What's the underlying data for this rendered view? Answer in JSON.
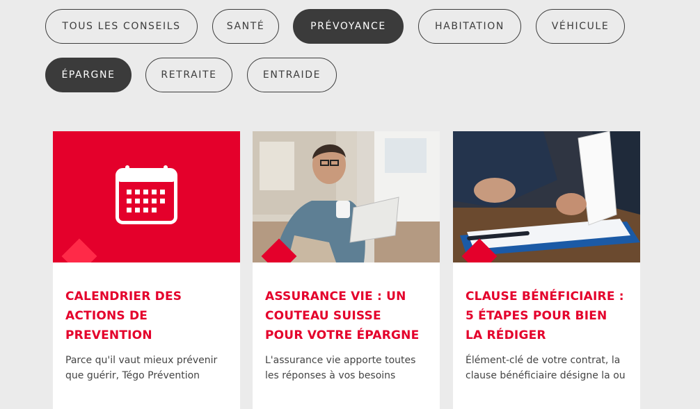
{
  "filters": {
    "items": [
      {
        "label": "TOUS LES CONSEILS",
        "active": false
      },
      {
        "label": "SANTÉ",
        "active": false
      },
      {
        "label": "PRÉVOYANCE",
        "active": true
      },
      {
        "label": "HABITATION",
        "active": false
      },
      {
        "label": "VÉHICULE",
        "active": false
      },
      {
        "label": "ÉPARGNE",
        "active": true
      },
      {
        "label": "RETRAITE",
        "active": false
      },
      {
        "label": "ENTRAIDE",
        "active": false
      }
    ]
  },
  "cards": [
    {
      "title_lines": [
        "CALENDRIER DES",
        "ACTIONS DE",
        "PREVENTION"
      ],
      "excerpt_lines": [
        "Parce qu'il vaut mieux prévenir",
        "que guérir, Tégo Prévention"
      ],
      "icon": "calendar-icon"
    },
    {
      "title_lines": [
        "ASSURANCE VIE : UN",
        "COUTEAU SUISSE",
        "POUR VOTRE ÉPARGNE"
      ],
      "excerpt_lines": [
        "L'assurance vie apporte toutes",
        "les réponses à vos besoins"
      ]
    },
    {
      "title_lines": [
        "CLAUSE BÉNÉFICIAIRE :",
        "5 ÉTAPES POUR BIEN",
        "LA RÉDIGER"
      ],
      "excerpt_lines": [
        "Élément-clé de votre contrat, la",
        "clause bénéficiaire désigne la ou"
      ]
    }
  ],
  "colors": {
    "accent": "#e4002b",
    "pill_active_bg": "#3b3b3b",
    "background": "#ebebeb"
  }
}
